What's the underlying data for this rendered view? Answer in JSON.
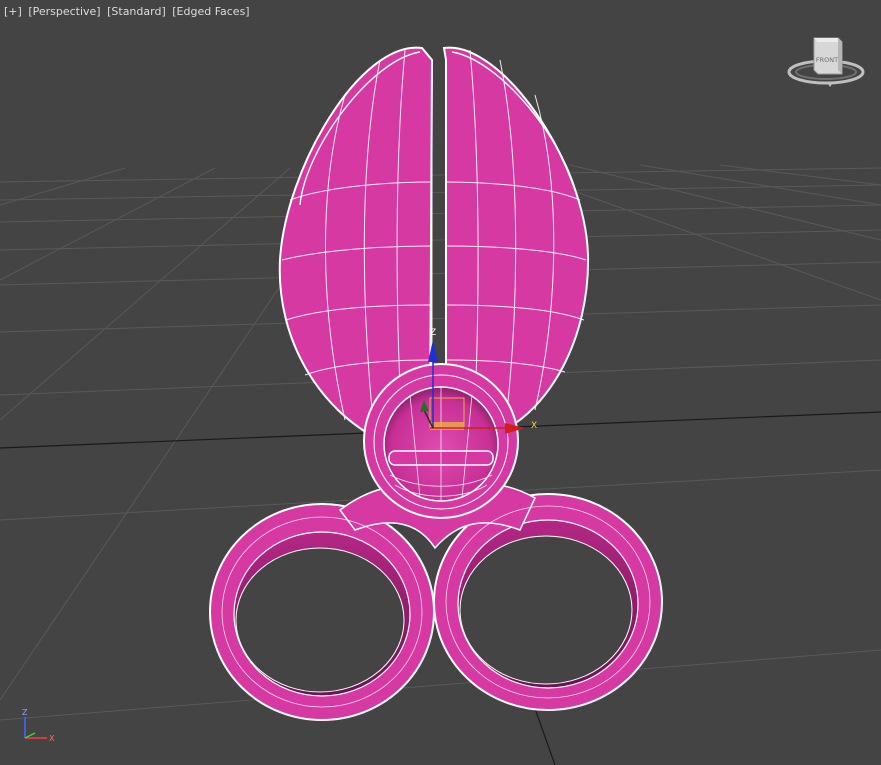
{
  "viewport": {
    "labels": {
      "plus_menu": "[+]",
      "view_menu": "[Perspective]",
      "shading_menu": "[Standard]",
      "display_menu": "[Edged Faces]"
    },
    "viewcube": {
      "face_label": "FRONT"
    },
    "gizmo": {
      "x_label": "X",
      "z_label": "Z"
    },
    "axis_tripod": {
      "z_label": "Z",
      "x_label": "X"
    }
  },
  "colors": {
    "background": "#444444",
    "grid": "#5a5a5a",
    "grid_axis": "#1a1a1a",
    "object_fill": "#d63aa2",
    "object_dark": "#8e1f6a",
    "wire": "#ffffff",
    "gizmo_x": "#d11f1f",
    "gizmo_z": "#1f2fd1",
    "gizmo_plane": "#e8b040"
  }
}
